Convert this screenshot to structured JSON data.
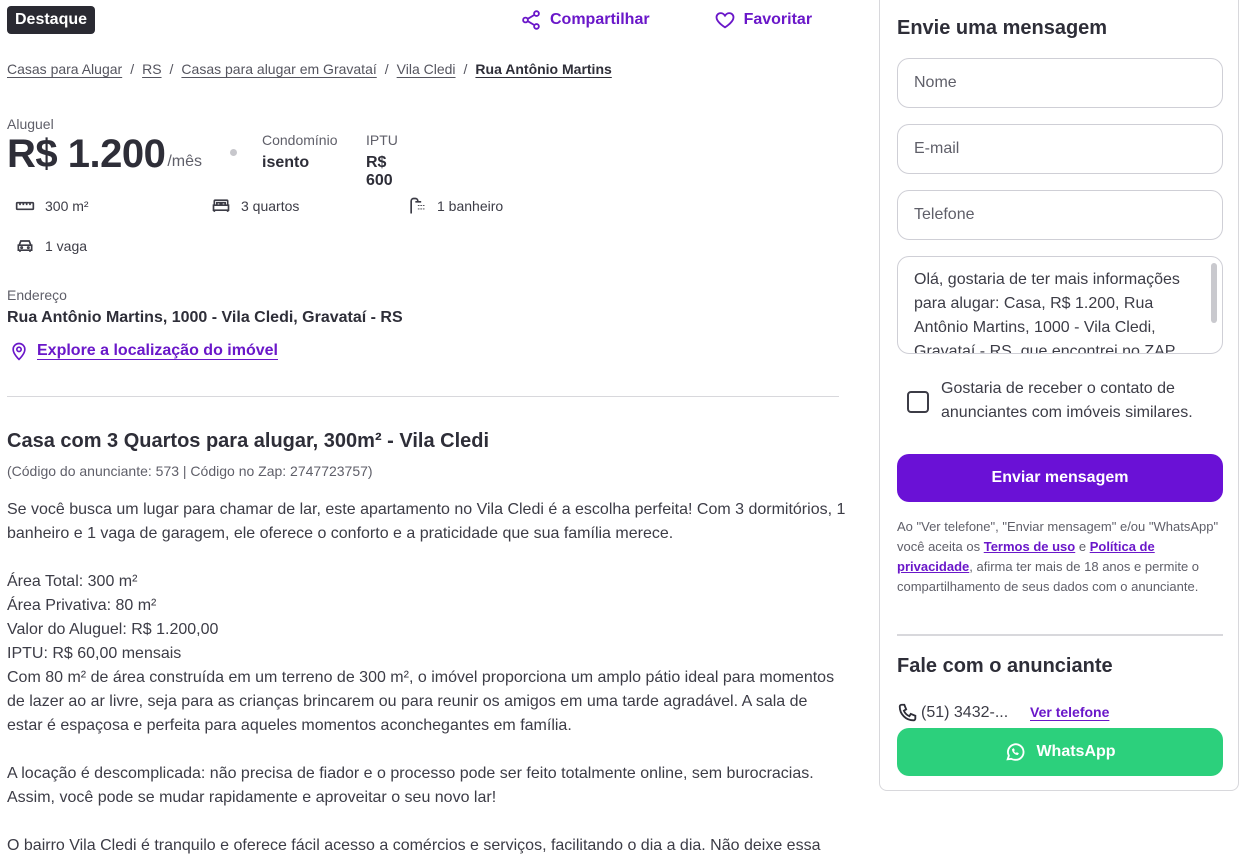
{
  "badge": "Destaque",
  "actions": {
    "share": "Compartilhar",
    "favorite": "Favoritar"
  },
  "breadcrumb": {
    "items": [
      "Casas para Alugar",
      "RS",
      "Casas para alugar em Gravataí",
      "Vila Cledi"
    ],
    "current": "Rua Antônio Martins",
    "separator": "/"
  },
  "price": {
    "label": "Aluguel",
    "value": "R$ 1.200",
    "period": "/mês",
    "condo_label": "Condomínio",
    "condo_value": "isento",
    "iptu_label": "IPTU",
    "iptu_value": "R$ 600"
  },
  "features": {
    "area": "300 m²",
    "rooms": "3 quartos",
    "bathrooms": "1 banheiro",
    "parking": "1 vaga"
  },
  "address": {
    "label": "Endereço",
    "value": "Rua Antônio Martins, 1000 - Vila Cledi, Gravataí - RS",
    "explore": "Explore a localização do imóvel"
  },
  "listing": {
    "title": "Casa com 3 Quartos para alugar, 300m² - Vila Cledi",
    "codes": "(Código do anunciante: 573 | Código no Zap: 2747723757)",
    "description": [
      "Se você busca um lugar para chamar de lar, este apartamento no Vila Cledi é a escolha perfeita! Com 3 dormitórios, 1 banheiro e 1 vaga de garagem, ele oferece o conforto e a praticidade que sua família merece.",
      "Área Total: 300 m²\nÁrea Privativa: 80 m²\nValor do Aluguel: R$ 1.200,00\nIPTU: R$ 60,00 mensais\nCom 80 m² de área construída em um terreno de 300 m², o imóvel proporciona um amplo pátio ideal para momentos de lazer ao ar livre, seja para as crianças brincarem ou para reunir os amigos em uma tarde agradável. A sala de estar é espaçosa e perfeita para aqueles momentos aconchegantes em família.",
      "A locação é descomplicada: não precisa de fiador e o processo pode ser feito totalmente online, sem burocracias. Assim, você pode se mudar rapidamente e aproveitar o seu novo lar!",
      "O bairro Vila Cledi é tranquilo e oferece fácil acesso a comércios e serviços, facilitando o dia a dia. Não deixe essa"
    ]
  },
  "form": {
    "title": "Envie uma mensagem",
    "name_placeholder": "Nome",
    "email_placeholder": "E-mail",
    "phone_placeholder": "Telefone",
    "message": "Olá, gostaria de ter mais informações para alugar: Casa, R$ 1.200, Rua Antônio Martins, 1000 - Vila Cledi, Gravataí - RS, que encontrei no ZAP.",
    "checkbox_label": "Gostaria de receber o contato de anunciantes com imóveis similares.",
    "submit": "Enviar mensagem",
    "legal_prefix": "Ao \"Ver telefone\", \"Enviar mensagem\" e/ou \"WhatsApp\" você aceita os ",
    "legal_terms": "Termos de uso",
    "legal_and": " e ",
    "legal_privacy": "Política de privacidade",
    "legal_suffix": ", afirma ter mais de 18 anos e permite o compartilhamento de seus dados com o anunciante."
  },
  "contact": {
    "title": "Fale com o anunciante",
    "phone": "(51) 3432-...",
    "show_phone": "Ver telefone",
    "whatsapp": "WhatsApp"
  },
  "colors": {
    "accent": "#6a11d6",
    "whatsapp": "#2cd07c",
    "badge": "#2a2a32"
  }
}
